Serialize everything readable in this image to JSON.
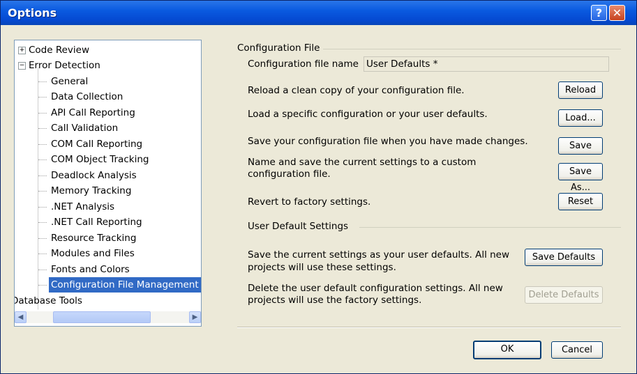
{
  "window": {
    "title": "Options"
  },
  "tree": {
    "items": [
      {
        "label": "Code Review",
        "expander": "+"
      },
      {
        "label": "Error Detection",
        "expander": "−"
      },
      {
        "label": "General"
      },
      {
        "label": "Data Collection"
      },
      {
        "label": "API Call Reporting"
      },
      {
        "label": "Call Validation"
      },
      {
        "label": "COM Call Reporting"
      },
      {
        "label": "COM Object Tracking"
      },
      {
        "label": "Deadlock Analysis"
      },
      {
        "label": "Memory Tracking"
      },
      {
        "label": ".NET Analysis"
      },
      {
        "label": ".NET Call Reporting"
      },
      {
        "label": "Resource Tracking"
      },
      {
        "label": "Modules and Files"
      },
      {
        "label": "Fonts and Colors"
      },
      {
        "label": "Configuration File Management",
        "selected": true
      },
      {
        "label": "Database Tools"
      }
    ]
  },
  "config": {
    "group_title": "Configuration File",
    "name_label": "Configuration file name",
    "name_value": "User Defaults *",
    "reload_text": "Reload a clean copy of your configuration file.",
    "reload_button": "Reload",
    "load_text": "Load a specific configuration or your user defaults.",
    "load_button": "Load...",
    "save_text": "Save your configuration file when you have made changes.",
    "save_button": "Save",
    "saveas_text_1": "Name and save the current settings to a custom",
    "saveas_text_2": "configuration file.",
    "saveas_button": "Save As...",
    "reset_text": "Revert to factory settings.",
    "reset_button": "Reset"
  },
  "user_defaults": {
    "group_title": "User Default Settings",
    "save_text_1": "Save the current settings as your user defaults.  All new",
    "save_text_2": "projects will use these settings.",
    "save_button": "Save Defaults",
    "delete_text_1": "Delete the user default configuration settings.  All new",
    "delete_text_2": "projects will use the factory settings.",
    "delete_button": "Delete Defaults"
  },
  "footer": {
    "ok_button": "OK",
    "cancel_button": "Cancel"
  },
  "icons": {
    "help": "?",
    "close": "✕"
  }
}
